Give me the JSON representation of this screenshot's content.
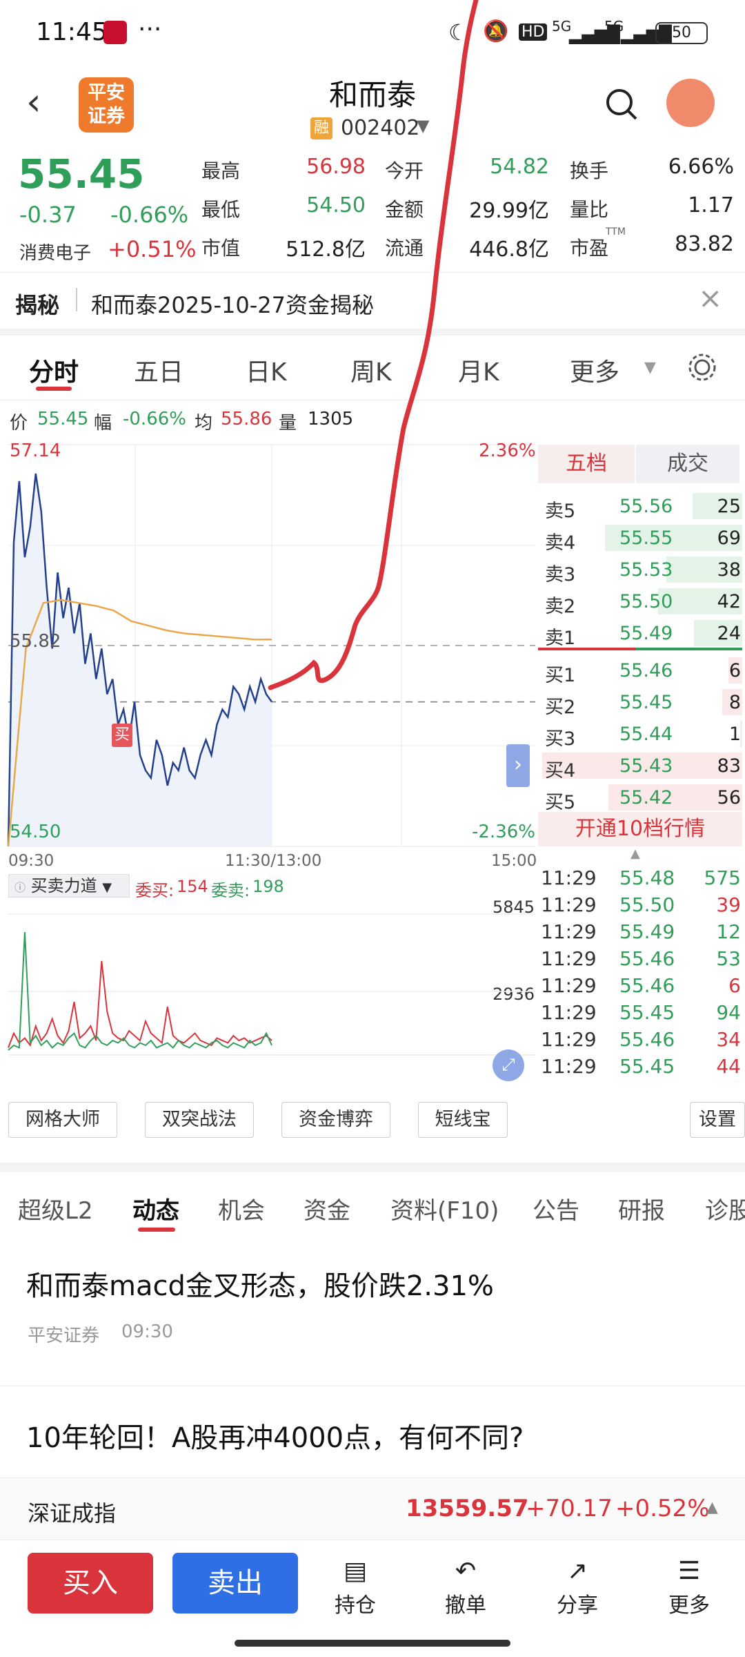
{
  "status": {
    "time": "11:45",
    "dots": "···",
    "battery": "50",
    "hd": "HD",
    "net1": "5G",
    "net2": "5G"
  },
  "header": {
    "title": "和而泰",
    "code": "002402",
    "margin_badge": "融",
    "logo_line1": "平安",
    "logo_line2": "证券"
  },
  "quote": {
    "price": "55.45",
    "change": "-0.37",
    "change_pct": "-0.66%",
    "sector": "消费电子",
    "sector_pct": "+0.51%",
    "rows": [
      [
        {
          "l": "最高",
          "v": "56.98",
          "c": "red"
        },
        {
          "l": "今开",
          "v": "54.82",
          "c": "green"
        },
        {
          "l": "换手",
          "v": "6.66%",
          "c": "dark"
        }
      ],
      [
        {
          "l": "最低",
          "v": "54.50",
          "c": "green"
        },
        {
          "l": "金额",
          "v": "29.99亿",
          "c": "dark"
        },
        {
          "l": "量比",
          "v": "1.17",
          "c": "dark"
        }
      ],
      [
        {
          "l": "市值",
          "v": "512.8亿",
          "c": "dark"
        },
        {
          "l": "流通",
          "v": "446.8亿",
          "c": "dark"
        },
        {
          "l": "市盈",
          "v": "83.82",
          "c": "dark"
        }
      ]
    ],
    "ttm": "TTM"
  },
  "reveal": {
    "tag": "揭秘",
    "text": "和而泰2025-10-27资金揭秘"
  },
  "ktabs": [
    "分时",
    "五日",
    "日K",
    "周K",
    "月K",
    "更多"
  ],
  "metrics": {
    "price_l": "价",
    "price": "55.45",
    "amp_l": "幅",
    "amp": "-0.66%",
    "avg_l": "均",
    "avg": "55.86",
    "vol_l": "量",
    "vol": "1305"
  },
  "chart": {
    "y_top": "57.14",
    "y_bottom": "54.50",
    "y_mid": "55.82",
    "pct_top": "2.36%",
    "pct_bottom": "-2.36%",
    "x_start": "09:30",
    "x_mid": "11:30/13:00",
    "x_end": "15:00",
    "buy_marker": "买"
  },
  "chart_data": {
    "type": "line",
    "x": [
      "09:30",
      "09:35",
      "09:40",
      "09:45",
      "09:50",
      "09:55",
      "10:00",
      "10:10",
      "10:20",
      "10:30",
      "10:40",
      "10:50",
      "11:00",
      "11:10",
      "11:20",
      "11:29"
    ],
    "series": [
      {
        "values": [
          54.5,
          56.8,
          56.95,
          56.2,
          56.3,
          56.1,
          56.0,
          55.2,
          54.9,
          54.95,
          54.98,
          55.1,
          55.4,
          55.38,
          55.5,
          55.45
        ]
      },
      {
        "values": [
          54.5,
          55.8,
          56.1,
          56.12,
          56.1,
          56.08,
          56.05,
          55.98,
          55.95,
          55.92,
          55.9,
          55.89,
          55.88,
          55.87,
          55.86,
          55.86
        ]
      }
    ],
    "ylim": [
      54.5,
      57.14
    ],
    "volume_ylim": [
      0,
      5845
    ]
  },
  "orderbook": {
    "tab1": "五档",
    "tab2": "成交",
    "asks": [
      {
        "l": "卖5",
        "p": "55.56",
        "v": "25"
      },
      {
        "l": "卖4",
        "p": "55.55",
        "v": "69"
      },
      {
        "l": "卖3",
        "p": "55.53",
        "v": "38"
      },
      {
        "l": "卖2",
        "p": "55.50",
        "v": "42"
      },
      {
        "l": "卖1",
        "p": "55.49",
        "v": "24"
      }
    ],
    "bids": [
      {
        "l": "买1",
        "p": "55.46",
        "v": "6"
      },
      {
        "l": "买2",
        "p": "55.45",
        "v": "8"
      },
      {
        "l": "买3",
        "p": "55.44",
        "v": "1"
      },
      {
        "l": "买4",
        "p": "55.43",
        "v": "83"
      },
      {
        "l": "买5",
        "p": "55.42",
        "v": "56"
      }
    ],
    "upgrade": "开通10档行情"
  },
  "ticks": [
    {
      "t": "11:29",
      "p": "55.48",
      "v": "575",
      "c": "green"
    },
    {
      "t": "11:29",
      "p": "55.50",
      "v": "39",
      "c": "red"
    },
    {
      "t": "11:29",
      "p": "55.49",
      "v": "12",
      "c": "green"
    },
    {
      "t": "11:29",
      "p": "55.46",
      "v": "53",
      "c": "green"
    },
    {
      "t": "11:29",
      "p": "55.46",
      "v": "6",
      "c": "red"
    },
    {
      "t": "11:29",
      "p": "55.45",
      "v": "94",
      "c": "green"
    },
    {
      "t": "11:29",
      "p": "55.46",
      "v": "34",
      "c": "red"
    },
    {
      "t": "11:29",
      "p": "55.45",
      "v": "44",
      "c": "red"
    }
  ],
  "vol": {
    "indicator": "买卖力道",
    "wb_l": "委买:",
    "wb": "154",
    "ws_l": "委卖:",
    "ws": "198",
    "top": "5845",
    "mid": "2936"
  },
  "tools": [
    "网格大师",
    "双突战法",
    "资金博弈",
    "短线宝",
    "设置"
  ],
  "newstabs": [
    "超级L2",
    "动态",
    "机会",
    "资金",
    "资料(F10)",
    "公告",
    "研报",
    "诊股"
  ],
  "news": [
    {
      "title": "和而泰macd金叉形态，股价跌2.31%",
      "source": "平安证券",
      "time": "09:30"
    },
    {
      "title": "10年轮回！A股再冲4000点，有何不同?"
    }
  ],
  "index": {
    "name": "深证成指",
    "value": "13559.57",
    "change": "+70.17",
    "pct": "+0.52%"
  },
  "bottom": {
    "buy": "买入",
    "sell": "卖出",
    "hold": "持仓",
    "cancel": "撤单",
    "share": "分享",
    "more": "更多"
  },
  "colors": {
    "red": "#d9343b",
    "green": "#2f9e59",
    "blue": "#2f6fe6",
    "brand": "#f07a2b"
  }
}
